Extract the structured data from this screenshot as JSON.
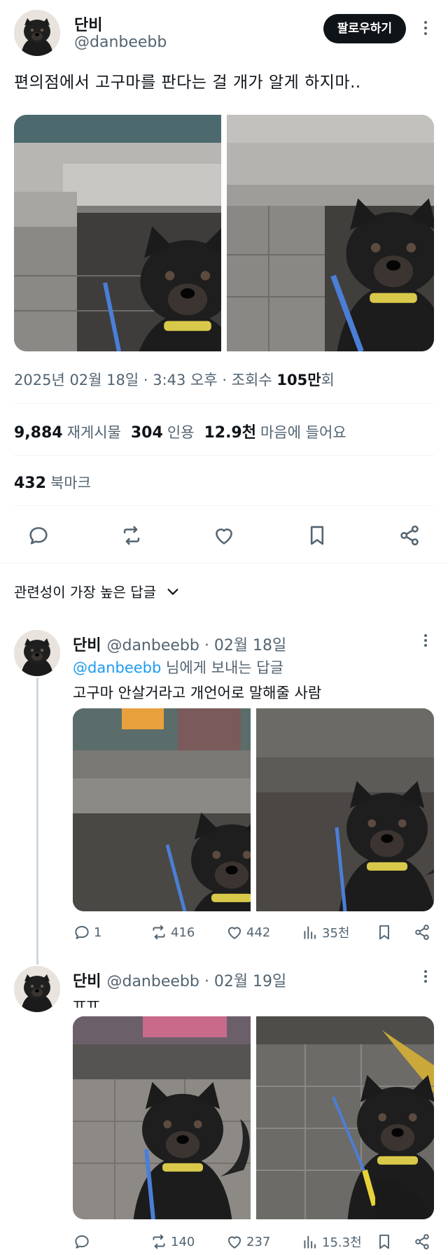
{
  "post": {
    "author_name": "단비",
    "author_handle": "@danbeebb",
    "follow_label": "팔로우하기",
    "text": "편의점에서 고구마를 판다는 걸 개가 알게 하지마..",
    "timestamp": "2025년 02월 18일 · 3:43 오후 · 조회수 ",
    "views": "105만",
    "views_suffix": "회",
    "stats": {
      "reposts_value": "9,884",
      "reposts_label": "재게시물",
      "quotes_value": "304",
      "quotes_label": "인용",
      "likes_value": "12.9천",
      "likes_label": "마음에 들어요",
      "bookmarks_value": "432",
      "bookmarks_label": "북마크"
    },
    "actions": [
      "reply-icon",
      "repost-icon",
      "like-icon",
      "bookmark-icon",
      "share-icon"
    ]
  },
  "sort": {
    "label": "관련성이 가장 높은 답글"
  },
  "replies": [
    {
      "author_name": "단비",
      "author_handle": "@danbeebb",
      "date": "· 02월 18일",
      "reply_to_mention": "@danbeebb",
      "reply_to_suffix": " 님에게 보내는 답글",
      "text": "고구마 안살거라고 개언어로 말해줄 사람",
      "replies_count": "1",
      "reposts_count": "416",
      "likes_count": "442",
      "views_count": "35천"
    },
    {
      "author_name": "단비",
      "author_handle": "@danbeebb",
      "date": "· 02월 19일",
      "text": "ㅠㅠ",
      "replies_count": "",
      "reposts_count": "140",
      "likes_count": "237",
      "views_count": "15.3천"
    }
  ],
  "colors": {
    "text": "#0f1419",
    "secondary": "#536471",
    "link": "#1d9bf0",
    "divider": "#eff3f4",
    "leash": "#4b7fd6"
  }
}
